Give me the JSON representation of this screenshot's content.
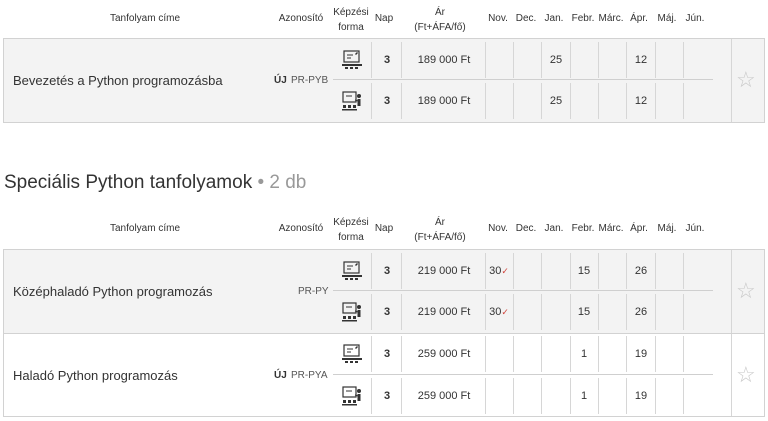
{
  "headers": {
    "course_title": "Tanfolyam címe",
    "id": "Azonosító",
    "format_line1": "Képzési",
    "format_line2": "forma",
    "days": "Nap",
    "price_line1": "Ár",
    "price_line2": "(Ft+ÁFA/fő)",
    "months": [
      "Nov.",
      "Dec.",
      "Jan.",
      "Febr.",
      "Márc.",
      "Ápr.",
      "Máj.",
      "Jún."
    ]
  },
  "section1": {
    "courses": [
      {
        "title": "Bevezetés a Python programozásba",
        "badge": "ÚJ",
        "code": "PR-PYB",
        "rows": [
          {
            "format_icon": "online-classroom-icon",
            "days": "3",
            "price": "189 000 Ft",
            "nov": "",
            "dec": "",
            "jan": "25",
            "febr": "",
            "marc": "",
            "apr": "12",
            "maj": "",
            "jun": ""
          },
          {
            "format_icon": "in-person-classroom-icon",
            "days": "3",
            "price": "189 000 Ft",
            "nov": "",
            "dec": "",
            "jan": "25",
            "febr": "",
            "marc": "",
            "apr": "12",
            "maj": "",
            "jun": ""
          }
        ]
      }
    ]
  },
  "section2": {
    "title": "Speciális Python tanfolyamok",
    "count": "• 2 db",
    "courses": [
      {
        "title": "Középhaladó Python programozás",
        "badge": "",
        "code": "PR-PY",
        "rows": [
          {
            "format_icon": "online-classroom-icon",
            "days": "3",
            "price": "219 000 Ft",
            "nov": "30",
            "nov_check": "✓",
            "dec": "",
            "jan": "",
            "febr": "15",
            "marc": "",
            "apr": "26",
            "maj": "",
            "jun": ""
          },
          {
            "format_icon": "in-person-classroom-icon",
            "days": "3",
            "price": "219 000 Ft",
            "nov": "30",
            "nov_check": "✓",
            "dec": "",
            "jan": "",
            "febr": "15",
            "marc": "",
            "apr": "26",
            "maj": "",
            "jun": ""
          }
        ]
      },
      {
        "title": "Haladó Python programozás",
        "badge": "ÚJ",
        "code": "PR-PYA",
        "rows": [
          {
            "format_icon": "online-classroom-icon",
            "days": "3",
            "price": "259 000 Ft",
            "nov": "",
            "dec": "",
            "jan": "",
            "febr": "1",
            "marc": "",
            "apr": "19",
            "maj": "",
            "jun": ""
          },
          {
            "format_icon": "in-person-classroom-icon",
            "days": "3",
            "price": "259 000 Ft",
            "nov": "",
            "dec": "",
            "jan": "",
            "febr": "1",
            "marc": "",
            "apr": "19",
            "maj": "",
            "jun": ""
          }
        ]
      }
    ]
  },
  "favorite_icon": "star-icon"
}
